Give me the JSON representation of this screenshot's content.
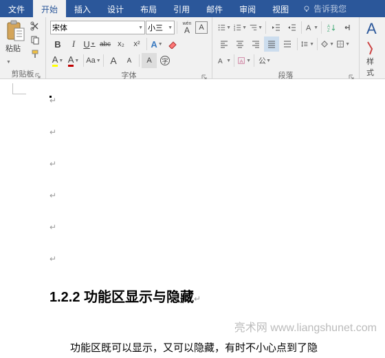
{
  "tabs": {
    "file": "文件",
    "home": "开始",
    "insert": "插入",
    "design": "设计",
    "layout": "布局",
    "references": "引用",
    "mailings": "邮件",
    "review": "审阅",
    "view": "视图"
  },
  "tellme": "告诉我您",
  "clipboard": {
    "paste_label": "粘贴",
    "group_label": "剪贴板"
  },
  "font": {
    "name": "宋体",
    "size": "小三",
    "wen_label": "wén",
    "bold": "B",
    "italic": "I",
    "underline": "U",
    "strike": "abc",
    "sub": "x₂",
    "sup": "x²",
    "grow": "A",
    "shrink": "A",
    "caps": "Aa",
    "clear": "A",
    "group_label": "字体"
  },
  "paragraph": {
    "group_label": "段落"
  },
  "styles": {
    "glyph": "A",
    "label": "样式",
    "group_label": "样式"
  },
  "document": {
    "mark": "↵",
    "heading": "1.2.2 功能区显示与隐藏",
    "heading_mark": "↵",
    "watermark_site": "亮术网 www.liangshunet.com",
    "body": "功能区既可以显示，又可以隐藏，有时不小心点到了隐"
  }
}
